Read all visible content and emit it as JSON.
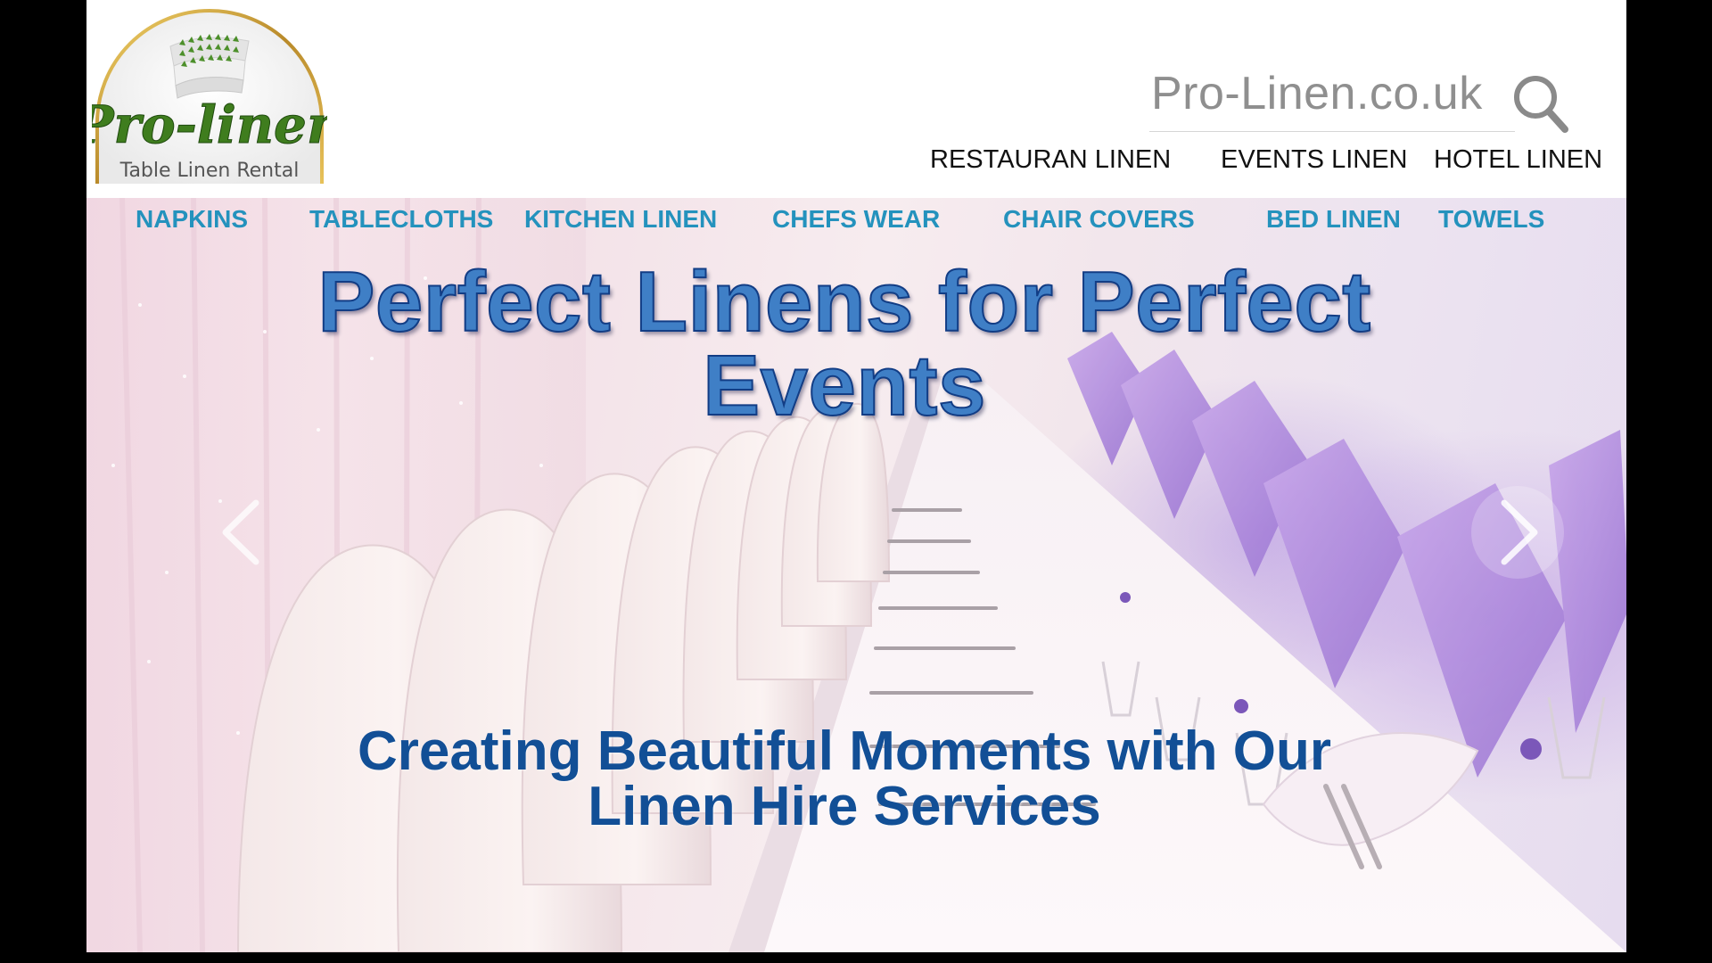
{
  "logo": {
    "brand": "Pro-linen",
    "tagline": "Table Linen Rental"
  },
  "search": {
    "placeholder": "Pro-Linen.co.uk",
    "icon": "search-icon"
  },
  "top_nav": {
    "items": [
      {
        "label": "RESTAURAN LINEN"
      },
      {
        "label": "EVENTS LINEN"
      },
      {
        "label": "HOTEL LINEN"
      }
    ]
  },
  "category_nav": {
    "items": [
      {
        "label": "NAPKINS"
      },
      {
        "label": "TABLECLOTHS"
      },
      {
        "label": "KITCHEN LINEN"
      },
      {
        "label": "CHEFS WEAR"
      },
      {
        "label": "CHAIR COVERS"
      },
      {
        "label": "BED LINEN"
      },
      {
        "label": "TOWELS"
      }
    ]
  },
  "hero": {
    "headline": "Perfect Linens for Perfect Events",
    "subheadline": "Creating Beautiful Moments with Our Linen Hire Services",
    "prev_icon": "chevron-left-icon",
    "next_icon": "chevron-right-icon"
  },
  "colors": {
    "category_link": "#2492bd",
    "headline_fill": "#3f7fc6",
    "headline_outline": "#123d85",
    "subheadline": "#124f96",
    "brand_green": "#3f7d1e"
  }
}
